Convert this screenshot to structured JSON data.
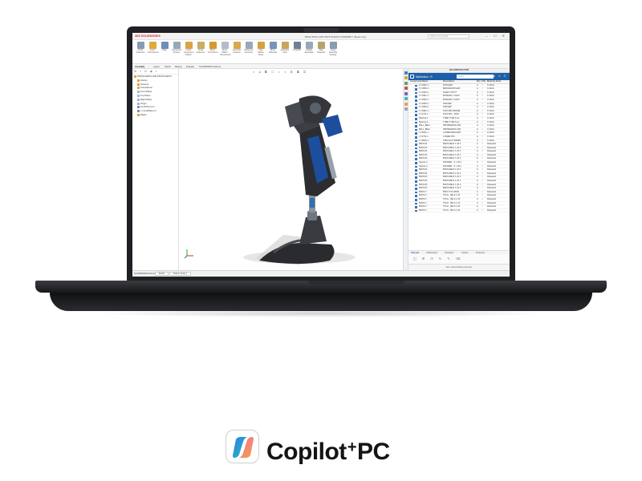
{
  "app": {
    "logo": "3DS SOLIDWORKS",
    "title": "BIOHUMAN AND PROSTHESIS ASSEMBLY (Read-only)",
    "search_placeholder": "Search Commands",
    "window_controls": "– ☐ ✕"
  },
  "ribbon": {
    "tools": [
      {
        "label": "Smart Fasteners",
        "color": "#8a9bb0"
      },
      {
        "label": "Insert Components",
        "color": "#e0a93b"
      },
      {
        "label": "Mate",
        "color": "#6d8fb8"
      },
      {
        "label": "Component Preview",
        "color": "#9aa7b8"
      },
      {
        "label": "Linear Component Pattern",
        "color": "#d9a441"
      },
      {
        "label": "Smart Fasteners",
        "color": "#c9ad63"
      },
      {
        "label": "Move Component",
        "color": "#d69a2d"
      },
      {
        "label": "Show Hidden Components",
        "color": "#b4bcc8"
      },
      {
        "label": "Assembly Features",
        "color": "#d8a94b"
      },
      {
        "label": "Reference Geometry",
        "color": "#9aa7b8"
      },
      {
        "label": "New Motion Study",
        "color": "#d3a13f"
      },
      {
        "label": "Bill of Materials",
        "color": "#7a94b6"
      },
      {
        "label": "Exploded View",
        "color": "#c9a55a"
      },
      {
        "label": "Instant3D",
        "color": "#6f7f94"
      },
      {
        "label": "Update Speedpak",
        "color": "#9aa7b8"
      },
      {
        "label": "Take Snapshot",
        "color": "#b7a46d"
      },
      {
        "label": "Large Assembly Settings",
        "color": "#8a9bb0"
      }
    ]
  },
  "command_tabs": [
    "Assembly",
    "Layout",
    "Sketch",
    "Markup",
    "Evaluate",
    "SOLIDWORKS Add-Ins"
  ],
  "view_toolbar_glyphs": "⌕ ⊙ ◧ ⬚ ◐ ◑ ⚙ ▣ ◫",
  "feature_tree": {
    "toolbar_glyphs": "⊞ ≡ ⊡ ◉ ◐",
    "items": [
      {
        "label": "PROSTHESIS AND PROSTHETIC",
        "type": "asm",
        "indent": false
      },
      {
        "label": "History",
        "type": "asm",
        "indent": true
      },
      {
        "label": "Sensors",
        "type": "asm",
        "indent": true
      },
      {
        "label": "Annotations",
        "type": "asm",
        "indent": true
      },
      {
        "label": "Front Plane",
        "type": "plane",
        "indent": true
      },
      {
        "label": "Top Plane",
        "type": "plane",
        "indent": true
      },
      {
        "label": "Right Plane",
        "type": "plane",
        "indent": true
      },
      {
        "label": "Origin",
        "type": "plane",
        "indent": true
      },
      {
        "label": "(f) 45 Pivot<1>",
        "type": "part",
        "indent": true
      },
      {
        "label": "(-) FootPlate<1>",
        "type": "part",
        "indent": true
      },
      {
        "label": "Mates",
        "type": "asm",
        "indent": true
      }
    ]
  },
  "side_icons": [
    "#3d7cc9",
    "#d9a441",
    "#5aa469",
    "#c0504d",
    "#8064a2",
    "#4bacc6",
    "#f79646",
    "#9aa7b8"
  ],
  "pdm": {
    "header": "SOLIDWORKS PDM",
    "session": "MySession - R",
    "search_placeholder": "Search",
    "icons": "⚙ ↻ ☰",
    "columns": {
      "name": "Component Name",
      "desc": "Description",
      "rev": "Rev",
      "chk": "Chk",
      "state": "Maturity State"
    },
    "rows": [
      {
        "name": "17-1601-1 -",
        "desc": "ROD END",
        "rev": "A",
        "chk": "✓",
        "state": "In Work"
      },
      {
        "name": "17-1650-1 -",
        "desc": "BRONZE BUSHIN",
        "rev": "A",
        "chk": "✓",
        "state": "In Work"
      },
      {
        "name": "17-1600-1 -",
        "desc": "SHAFT PIVOT",
        "rev": "A",
        "chk": "✓",
        "state": "In Work"
      },
      {
        "name": "17-1601-1 -",
        "desc": "BUSHING, CLEVI",
        "rev": "A",
        "chk": "✓",
        "state": "In Work"
      },
      {
        "name": "17-1601-2 -",
        "desc": "BUSHING, CLEVI",
        "rev": "A",
        "chk": "✓",
        "state": "In Work"
      },
      {
        "name": "17-1660-1 -",
        "desc": "SPACER",
        "rev": "A",
        "chk": "✓",
        "state": "In Work"
      },
      {
        "name": "17-1660-2 -",
        "desc": "SPACER",
        "rev": "A",
        "chk": "✓",
        "state": "In Work"
      },
      {
        "name": "17-1661-1 -",
        "desc": "FCM 2PE WASHE",
        "rev": "A",
        "chk": "✓",
        "state": "In Work"
      },
      {
        "name": "17-0711-1 -",
        "desc": "FCM 2PG - ROD",
        "rev": "A",
        "chk": "✓",
        "state": "In Work"
      },
      {
        "name": "Bearing-1 -",
        "desc": "TUBE TYPE N-LL",
        "rev": "A",
        "chk": "✓",
        "state": "In Work"
      },
      {
        "name": "Bearing-2 -",
        "desc": "TUBE TYPE N-LL",
        "rev": "A",
        "chk": "✓",
        "state": "In Work"
      },
      {
        "name": "BALL_BEAr",
        "desc": "IMP BEARING 460",
        "rev": "A",
        "chk": "✓",
        "state": "In Work"
      },
      {
        "name": "BALL_BEAr",
        "desc": "IMP BEARING 460",
        "rev": "A",
        "chk": "✓",
        "state": "In Work"
      },
      {
        "name": "17-3811-1 -",
        "desc": "LOWER BRACKET",
        "rev": "A",
        "chk": "✓",
        "state": "In Work"
      },
      {
        "name": "17-3711-1 -",
        "desc": "LOWER PIN",
        "rev": "A",
        "chk": "✓",
        "state": "In Work"
      },
      {
        "name": "17-9810-1 -",
        "desc": "CIRCLE PYRAMID",
        "rev": "A",
        "chk": "✓",
        "state": "In Work"
      },
      {
        "name": "BNCS-B -",
        "desc": "BNCS-BE-D 1 20 4",
        "rev": "A",
        "chk": "✓",
        "state": "Released"
      },
      {
        "name": "BNCS-B -",
        "desc": "BNCS-BE-D 1 20 4",
        "rev": "A",
        "chk": "✓",
        "state": "Released"
      },
      {
        "name": "BNCS-B -",
        "desc": "BNCS-BE-D 1 20 4",
        "rev": "A",
        "chk": "✓",
        "state": "Released"
      },
      {
        "name": "BNCS-B -",
        "desc": "BNCS-BE-D 1 20 4",
        "rev": "A",
        "chk": "✓",
        "state": "Released"
      },
      {
        "name": "BNCS-B -",
        "desc": "BNCS-BE-D 1 20 4",
        "rev": "A",
        "chk": "✓",
        "state": "Released"
      },
      {
        "name": "Spacer-1 -",
        "desc": "WASHER - 0 x 18 a",
        "rev": "A",
        "chk": "✓",
        "state": "Released"
      },
      {
        "name": "Spacer-2 -",
        "desc": "WASHER - 0 x 18 a",
        "rev": "A",
        "chk": "✓",
        "state": "Released"
      },
      {
        "name": "BNCS-B -",
        "desc": "BNCS-BE-D 1 20 4",
        "rev": "A",
        "chk": "✓",
        "state": "Released"
      },
      {
        "name": "BNCS-B -",
        "desc": "BNCS-BE-D 1 20 4",
        "rev": "A",
        "chk": "✓",
        "state": "Released"
      },
      {
        "name": "BNCS-B -",
        "desc": "BNCS-BE-D 1 20 4",
        "rev": "A",
        "chk": "✓",
        "state": "Released"
      },
      {
        "name": "BNCS-B -",
        "desc": "BNCS-BE-D 1 20 4",
        "rev": "A",
        "chk": "✓",
        "state": "Released"
      },
      {
        "name": "BNCS-B -",
        "desc": "BNCS-BE-D 1 20 4",
        "rev": "A",
        "chk": "✓",
        "state": "Released"
      },
      {
        "name": "BNCS-B -",
        "desc": "BNCS-BE-D 1 20 4",
        "rev": "A",
        "chk": "✓",
        "state": "Released"
      },
      {
        "name": "BNCS-T -",
        "desc": "BNLT 5 15 LRMS",
        "rev": "A",
        "chk": "✓",
        "state": "Released"
      },
      {
        "name": "BNCS-T -",
        "desc": "TFCG - BE-K 1 20",
        "rev": "A",
        "chk": "✓",
        "state": "Released"
      },
      {
        "name": "BNCS-T -",
        "desc": "TFCG - BE-K 1 20",
        "rev": "A",
        "chk": "✓",
        "state": "Released"
      },
      {
        "name": "BNCS-T -",
        "desc": "TFCG - BE-K 1 20",
        "rev": "A",
        "chk": "✓",
        "state": "Released"
      },
      {
        "name": "BNCS-T -",
        "desc": "TFCG - BE-K 1 20",
        "rev": "A",
        "chk": "✓",
        "state": "Released"
      },
      {
        "name": "BNCS-T -",
        "desc": "TFCG - BE-K 1 20",
        "rev": "A",
        "chk": "✓",
        "state": "Released"
      }
    ],
    "tabs": [
      "Lifecycle",
      "Collaboration",
      "Simulation",
      "Options",
      "Properties"
    ],
    "tools_glyphs": "◫ ⊞ ⊡ ↻ ✎ ⌫",
    "footer": "Date: Default   Editing Assembly"
  },
  "statusbar": {
    "left": "SOLIDWORKS Premium",
    "tabs": [
      "Model",
      "Motion Study 1"
    ]
  },
  "badge": {
    "word": "Copilot",
    "plus": "+",
    "suffix": "PC"
  },
  "colors": {
    "laptop_body": "#1f2023",
    "pdm_blue": "#1d5fa8",
    "solidworks_red": "#d8262c"
  }
}
